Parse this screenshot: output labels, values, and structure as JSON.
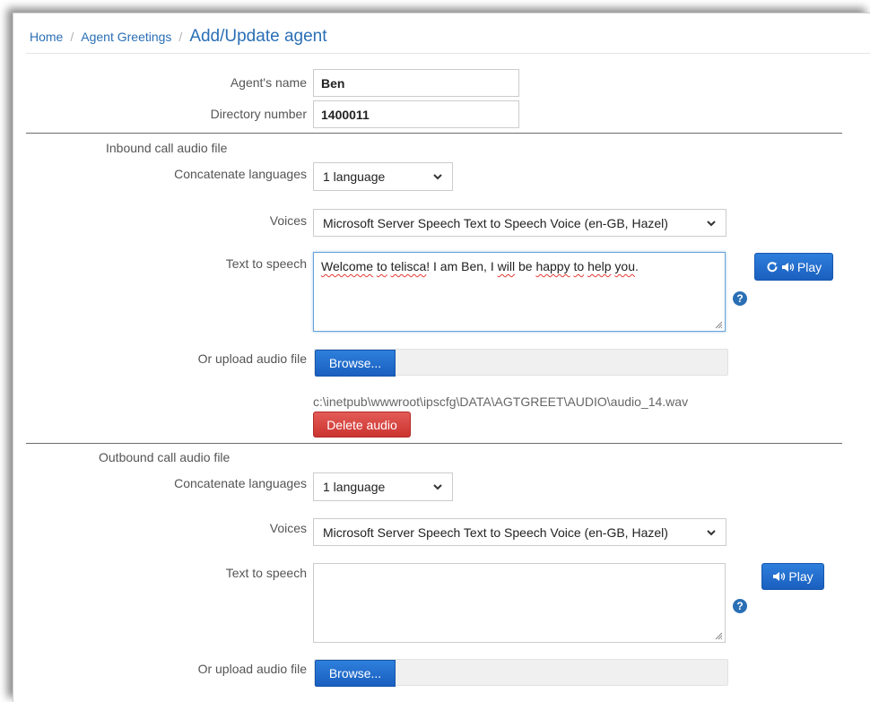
{
  "breadcrumb": {
    "home": "Home",
    "section": "Agent Greetings",
    "current": "Add/Update agent",
    "separator": "/"
  },
  "agent": {
    "name_label": "Agent's name",
    "name_value": "Ben",
    "directory_label": "Directory number",
    "directory_value": "1400011"
  },
  "inbound": {
    "title": "Inbound call audio file",
    "concat_label": "Concatenate languages",
    "concat_value": "1 language",
    "voices_label": "Voices",
    "voices_value": "Microsoft Server Speech Text to Speech Voice (en-GB, Hazel)",
    "tts_label": "Text to speech",
    "tts_parts": [
      {
        "text": "Welcome",
        "spell": true
      },
      {
        "text": " ",
        "spell": false
      },
      {
        "text": "to",
        "spell": true
      },
      {
        "text": " ",
        "spell": false
      },
      {
        "text": "telisca",
        "spell": true
      },
      {
        "text": "! I am Ben, I ",
        "spell": false
      },
      {
        "text": "will",
        "spell": true
      },
      {
        "text": " be ",
        "spell": false
      },
      {
        "text": "happy",
        "spell": true
      },
      {
        "text": " ",
        "spell": false
      },
      {
        "text": "to",
        "spell": true
      },
      {
        "text": " ",
        "spell": false
      },
      {
        "text": "help",
        "spell": true
      },
      {
        "text": " ",
        "spell": false
      },
      {
        "text": "you",
        "spell": true
      },
      {
        "text": ".",
        "spell": false
      }
    ],
    "play_label": "Play",
    "upload_label": "Or upload audio file",
    "browse_label": "Browse...",
    "file_path": "c:\\inetpub\\wwwroot\\ipscfg\\DATA\\AGTGREET\\AUDIO\\audio_14.wav",
    "delete_label": "Delete audio"
  },
  "outbound": {
    "title": "Outbound call audio file",
    "concat_label": "Concatenate languages",
    "concat_value": "1 language",
    "voices_label": "Voices",
    "voices_value": "Microsoft Server Speech Text to Speech Voice (en-GB, Hazel)",
    "tts_label": "Text to speech",
    "tts_value": "",
    "play_label": "Play",
    "upload_label": "Or upload audio file",
    "browse_label": "Browse..."
  },
  "help_glyph": "?",
  "icons": {
    "refresh": "refresh-icon",
    "speaker": "speaker-icon",
    "chevron": "chevron-down-icon",
    "help": "help-icon",
    "grip": "resize-grip-icon"
  },
  "colors": {
    "primary": "#1a6ad1",
    "danger": "#d9413d",
    "link": "#2a6fb5"
  }
}
